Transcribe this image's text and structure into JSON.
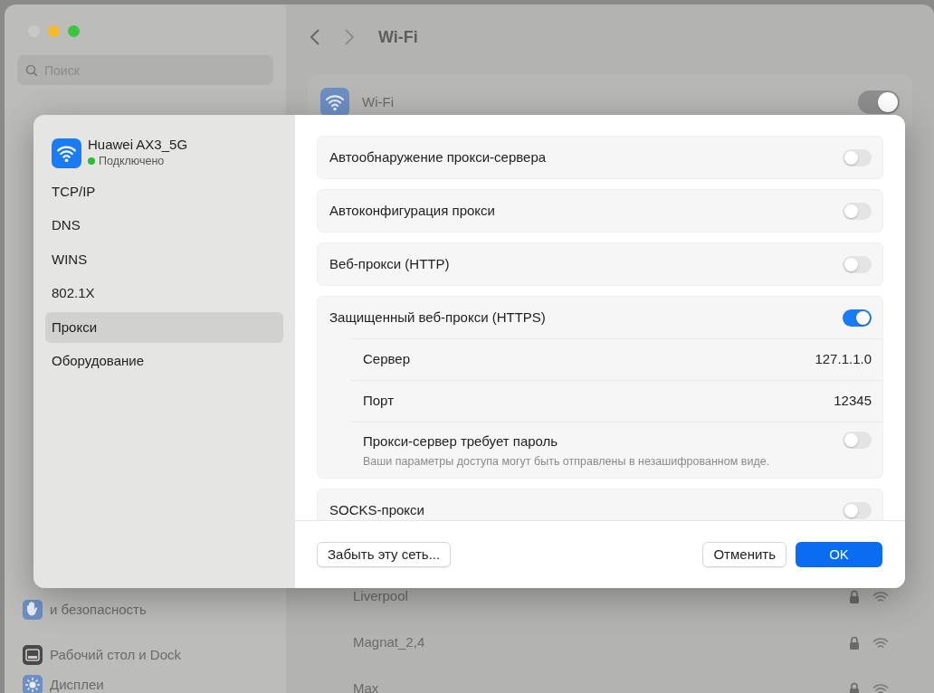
{
  "window": {
    "search_placeholder": "Поиск",
    "title": "Wi-Fi"
  },
  "sidebar": {
    "items": [
      {
        "label": "и безопасность",
        "kind": "hand"
      },
      {
        "label": "Рабочий стол и Dock",
        "kind": "dock"
      },
      {
        "label": "Дисплеи",
        "kind": "sun"
      }
    ]
  },
  "wifi": {
    "label": "Wi-Fi",
    "on": true
  },
  "networks": [
    {
      "name": "Liverpool"
    },
    {
      "name": "Magnat_2,4"
    },
    {
      "name": "Max"
    }
  ],
  "sheet": {
    "network": {
      "name": "Huawei AX3_5G",
      "status": "Подключено"
    },
    "tabs": [
      {
        "label": "TCP/IP",
        "selected": false
      },
      {
        "label": "DNS",
        "selected": false
      },
      {
        "label": "WINS",
        "selected": false
      },
      {
        "label": "802.1X",
        "selected": false
      },
      {
        "label": "Прокси",
        "selected": true
      },
      {
        "label": "Оборудование",
        "selected": false
      }
    ],
    "proxies": [
      {
        "label": "Автообнаружение прокси-сервера",
        "on": false
      },
      {
        "label": "Автоконфигурация прокси",
        "on": false
      },
      {
        "label": "Веб-прокси (HTTP)",
        "on": false
      },
      {
        "label": "Защищенный веб-прокси (HTTPS)",
        "on": true,
        "server_label": "Сервер",
        "server": "127.1.1.0",
        "port_label": "Порт",
        "port": "12345",
        "auth": {
          "label": "Прокси-сервер требует пароль",
          "note": "Ваши параметры доступа могут быть отправлены в незашифрованном виде.",
          "on": false
        }
      },
      {
        "label": "SOCKS-прокси",
        "on": false
      }
    ],
    "buttons": {
      "forget": "Забыть эту сеть...",
      "cancel": "Отменить",
      "ok": "OK"
    }
  }
}
